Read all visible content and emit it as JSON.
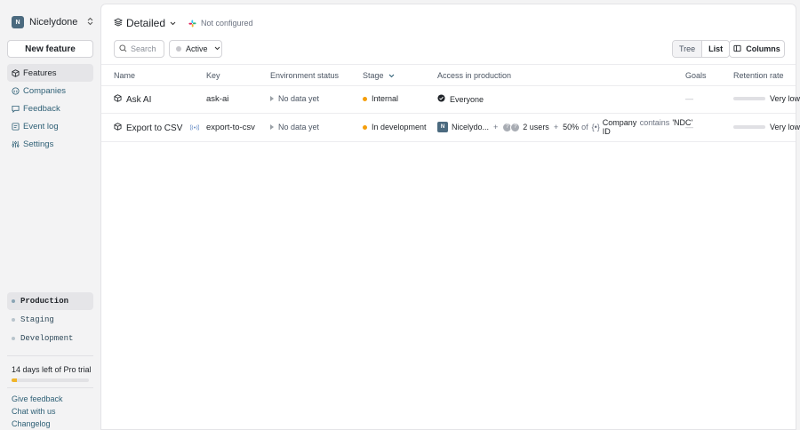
{
  "sidebar": {
    "org_initial": "N",
    "org_name": "Nicelydone",
    "new_feature_label": "New feature",
    "nav": [
      {
        "label": "Features",
        "icon": "box-icon",
        "active": true
      },
      {
        "label": "Companies",
        "icon": "companies-icon"
      },
      {
        "label": "Feedback",
        "icon": "feedback-icon"
      },
      {
        "label": "Event log",
        "icon": "event-log-icon"
      },
      {
        "label": "Settings",
        "icon": "settings-icon"
      }
    ],
    "environments": [
      {
        "label": "Production",
        "active": true
      },
      {
        "label": "Staging"
      },
      {
        "label": "Development"
      }
    ],
    "trial_text": "14 days left of Pro trial",
    "trial_progress": 0.07,
    "footer_links": [
      "Give feedback",
      "Chat with us",
      "Changelog"
    ]
  },
  "header": {
    "view_title": "Detailed",
    "integration_status": "Not configured"
  },
  "filters": {
    "search_placeholder": "Search",
    "status_label": "Active",
    "view_tree": "Tree",
    "view_list": "List",
    "columns_label": "Columns"
  },
  "table": {
    "columns": {
      "name": "Name",
      "key": "Key",
      "environment_status": "Environment status",
      "stage": "Stage",
      "access": "Access in production",
      "goals": "Goals",
      "retention": "Retention rate"
    },
    "rows": [
      {
        "name": "Ask AI",
        "key": "ask-ai",
        "env_status": "No data yet",
        "stage": "Internal",
        "access": "Everyone",
        "goals": "—",
        "retention": "Very low"
      },
      {
        "name": "Export to CSV",
        "key": "export-to-csv",
        "env_status": "No data yet",
        "stage": "In development",
        "access_company_initial": "N",
        "access_company": "Nicelydo...",
        "access_plus_1": "+",
        "access_users_avatar_1": "?",
        "access_users_avatar_2": "?",
        "access_users": "2 users",
        "access_plus_2": "+",
        "access_percent": "50%",
        "access_of": "of",
        "access_segment_field": "Company ID",
        "access_segment_op": "contains",
        "access_segment_value": "'NDC'",
        "goals": "—",
        "retention": "Very low"
      }
    ]
  },
  "colors": {
    "stage_dot": "#f59e0b",
    "trial_fill": "#f0b429",
    "link": "#2f6076"
  }
}
